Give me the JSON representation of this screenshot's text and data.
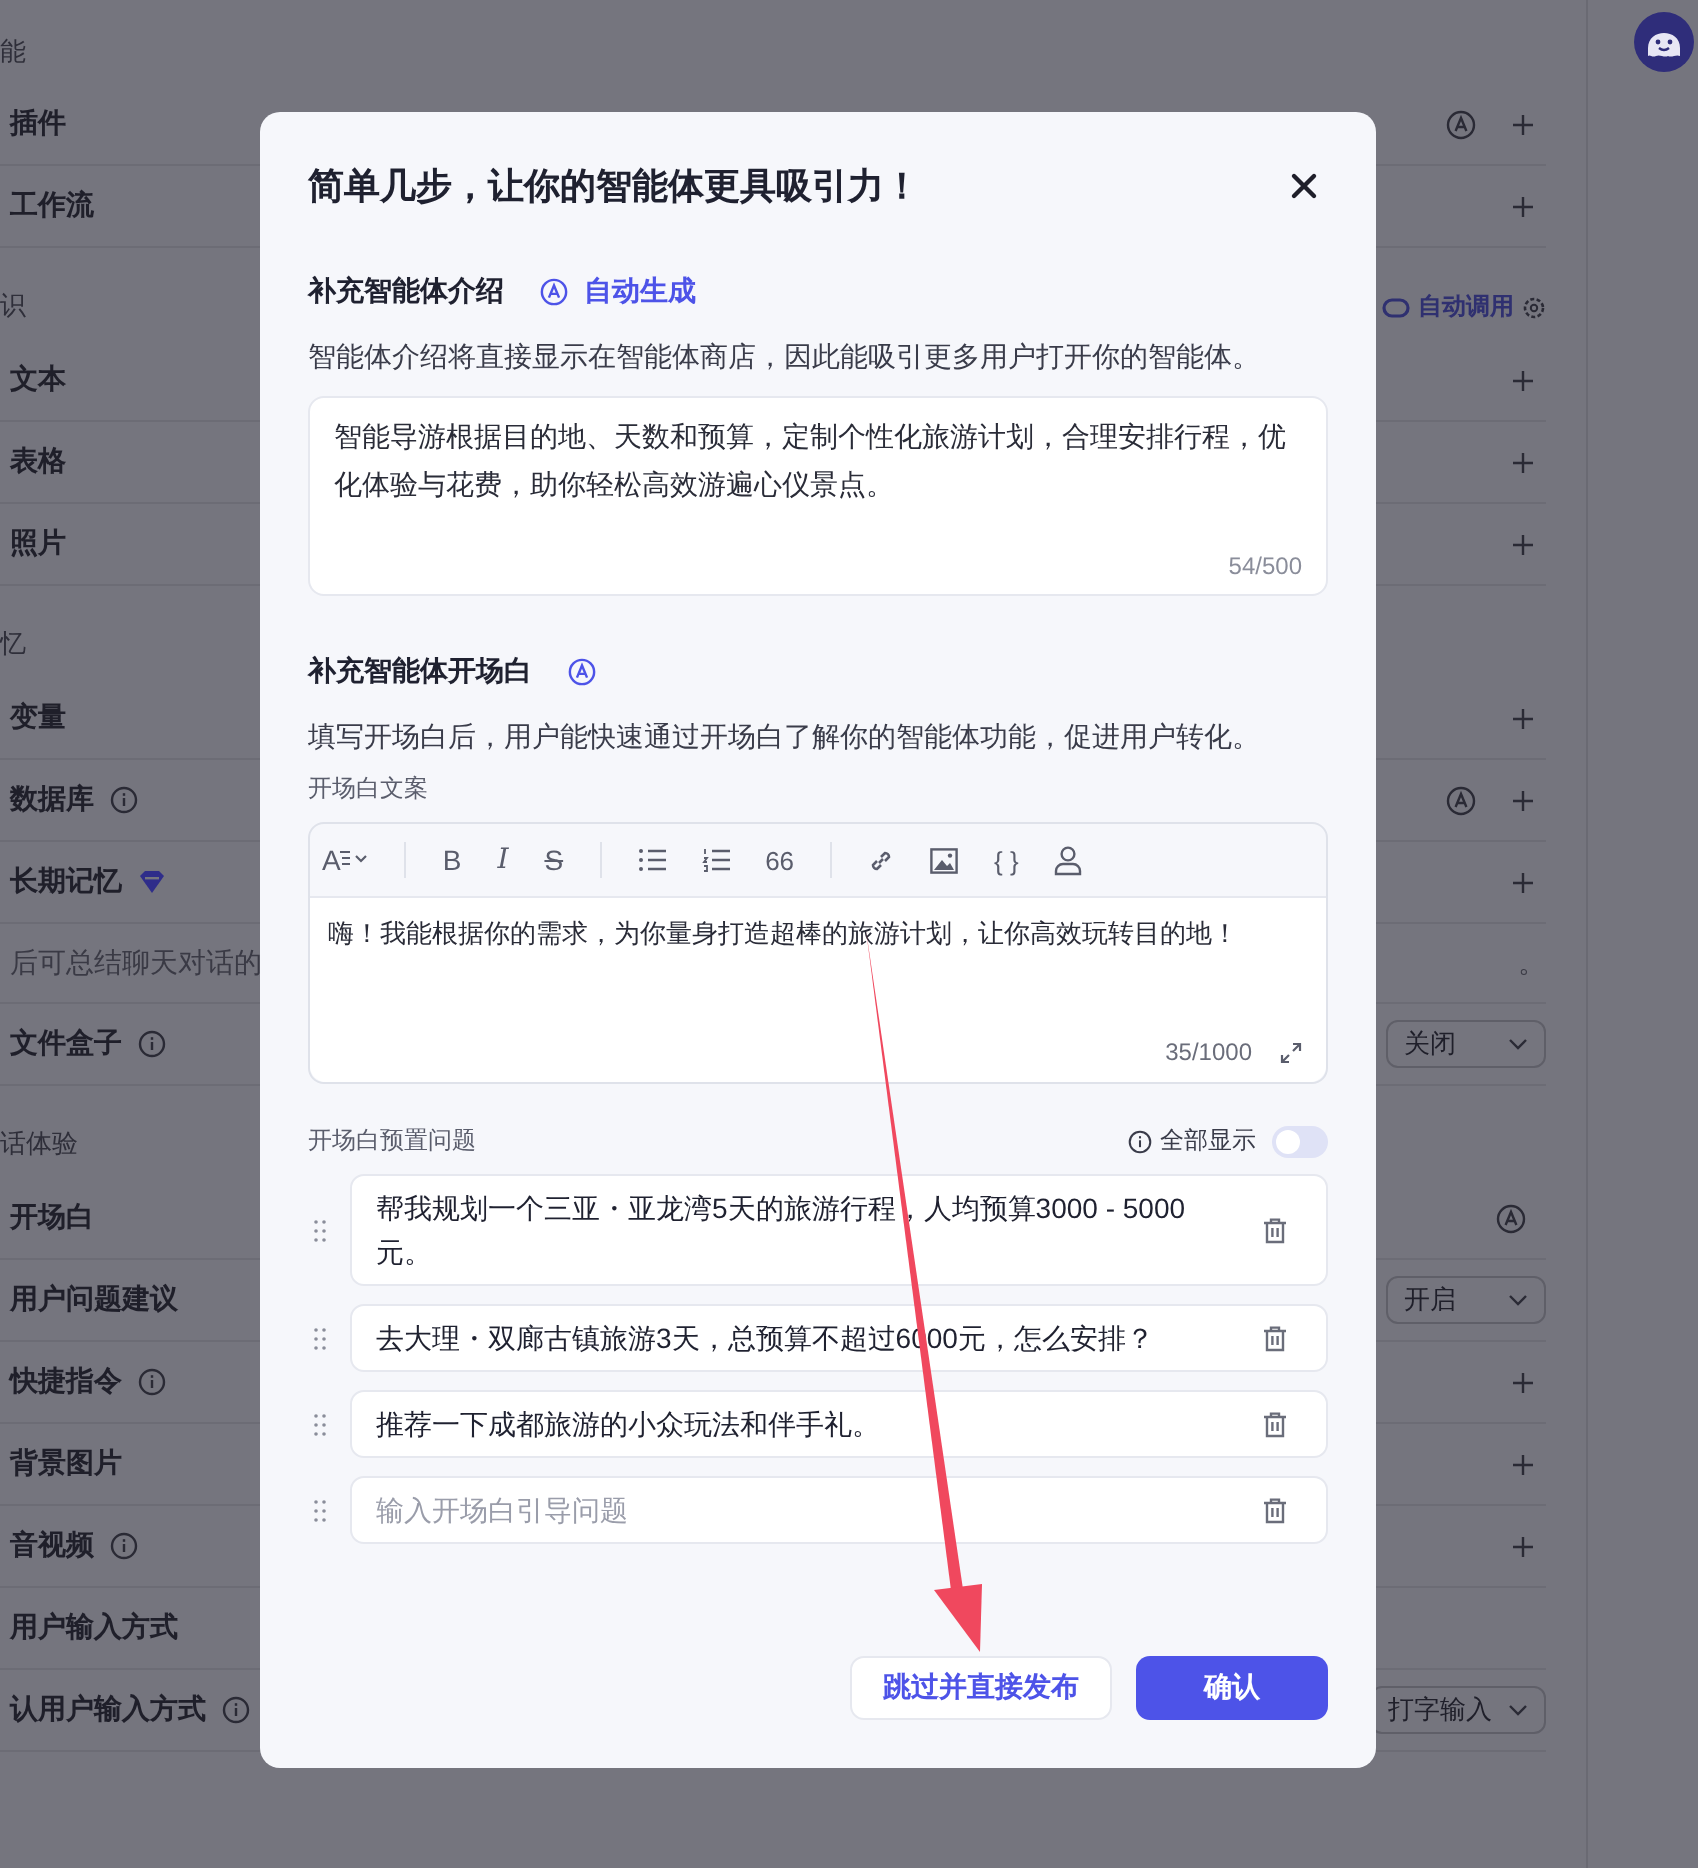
{
  "background": {
    "sections": [
      {
        "title": "能",
        "items": [
          {
            "kind": "row",
            "label": "插件",
            "ai_icon": true,
            "add_button": true
          },
          {
            "kind": "row",
            "label": "工作流",
            "add_button": true
          }
        ]
      },
      {
        "title": "识",
        "auto_call": "自动调用",
        "items": [
          {
            "kind": "row",
            "label": "文本",
            "add_button": true
          },
          {
            "kind": "row",
            "label": "表格",
            "add_button": true
          },
          {
            "kind": "row",
            "label": "照片",
            "add_button": true
          }
        ]
      },
      {
        "title": "忆",
        "items": [
          {
            "kind": "row",
            "label": "变量",
            "add_button": true
          },
          {
            "kind": "row",
            "label": "数据库",
            "info_icon": true,
            "ai_icon": true,
            "add_button": true
          },
          {
            "kind": "row",
            "label": "长期记忆",
            "gem_icon": true,
            "add_button": true
          },
          {
            "kind": "note",
            "label": "后可总结聊天对话的",
            "tail": "。"
          },
          {
            "kind": "row",
            "label": "文件盒子",
            "info_icon": true,
            "select": "关闭"
          }
        ]
      },
      {
        "title": "话体验",
        "items": [
          {
            "kind": "row",
            "label": "开场白",
            "ai_icon": true
          },
          {
            "kind": "row",
            "label": "用户问题建议",
            "select": "开启"
          },
          {
            "kind": "row",
            "label": "快捷指令",
            "info_icon": true,
            "add_button": true
          },
          {
            "kind": "row",
            "label": "背景图片",
            "add_button": true
          },
          {
            "kind": "row",
            "label": "音视频",
            "info_icon": true,
            "add_button": true
          },
          {
            "kind": "row",
            "label": "用户输入方式"
          },
          {
            "kind": "row",
            "label": "认用户输入方式",
            "info_icon": true,
            "select": "打字输入"
          }
        ]
      }
    ]
  },
  "dialog": {
    "title": "简单几步，让你的智能体更具吸引力！",
    "intro": {
      "heading": "补充智能体介绍",
      "auto_generate": "自动生成",
      "description": "智能体介绍将直接显示在智能体商店，因此能吸引更多用户打开你的智能体。",
      "value": "智能导游根据目的地、天数和预算，定制个性化旅游计划，合理安排行程，优化体验与花费，助你轻松高效游遍心仪景点。",
      "counter": "54/500"
    },
    "opening": {
      "heading": "补充智能体开场白",
      "description": "填写开场白后，用户能快速通过开场白了解你的智能体功能，促进用户转化。",
      "editor_label": "开场白文案",
      "toolbar": [
        [
          {
            "kind": "format",
            "glyph": "A"
          }
        ],
        [
          {
            "kind": "bold",
            "glyph": "B"
          },
          {
            "kind": "italic",
            "glyph": "I"
          },
          {
            "kind": "strike",
            "glyph": "S"
          }
        ],
        [
          {
            "kind": "bullet"
          },
          {
            "kind": "numbered"
          },
          {
            "kind": "quote",
            "glyph": "66"
          }
        ],
        [
          {
            "kind": "link"
          },
          {
            "kind": "image"
          },
          {
            "kind": "code",
            "glyph": "{ }"
          },
          {
            "kind": "mention"
          }
        ]
      ],
      "value": "嗨！我能根据你的需求，为你量身打造超棒的旅游计划，让你高效玩转目的地！",
      "counter": "35/1000",
      "questions_label": "开场白预置问题",
      "show_all": {
        "label": "全部显示",
        "on": false
      },
      "questions": [
        {
          "value": "帮我规划一个三亚・亚龙湾5天的旅游行程，人均预算3000 - 5000元。"
        },
        {
          "value": "去大理・双廊古镇旅游3天，总预算不超过6000元，怎么安排？"
        },
        {
          "value": "推荐一下成都旅游的小众玩法和伴手礼。"
        },
        {
          "placeholder": "输入开场白引导问题"
        }
      ]
    },
    "buttons": [
      {
        "label": "跳过并直接发布",
        "kind": "secondary"
      },
      {
        "label": "确认",
        "kind": "primary"
      }
    ]
  }
}
